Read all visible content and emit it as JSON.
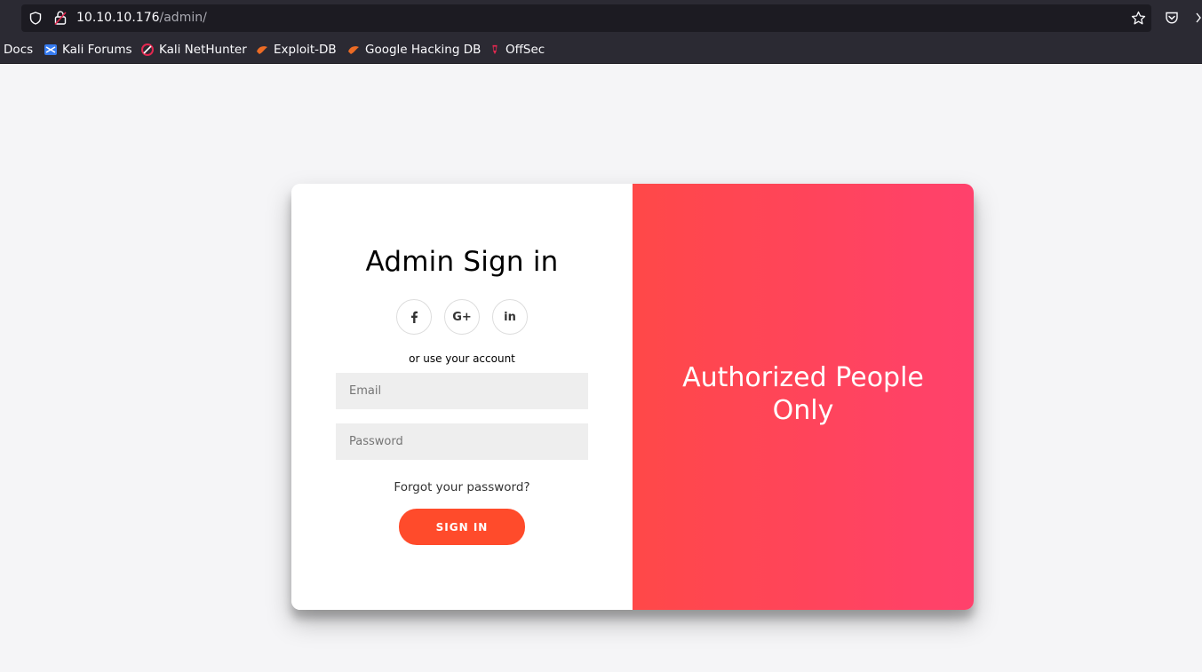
{
  "browser": {
    "url_host": "10.10.10.176",
    "url_path": "/admin/",
    "bookmarks": [
      {
        "label": "i Docs",
        "icon": "kali-docs-icon"
      },
      {
        "label": "Kali Forums",
        "icon": "kali-forums-icon"
      },
      {
        "label": "Kali NetHunter",
        "icon": "kali-nethunter-icon"
      },
      {
        "label": "Exploit-DB",
        "icon": "exploit-db-icon"
      },
      {
        "label": "Google Hacking DB",
        "icon": "google-hacking-db-icon"
      },
      {
        "label": "OffSec",
        "icon": "offsec-icon"
      }
    ]
  },
  "login": {
    "title": "Admin Sign in",
    "social": [
      {
        "label": "f",
        "icon": "facebook-icon"
      },
      {
        "label": "G+",
        "icon": "google-plus-icon"
      },
      {
        "label": "in",
        "icon": "linkedin-icon"
      }
    ],
    "alt_text": "or use your account",
    "email_placeholder": "Email",
    "password_placeholder": "Password",
    "forgot_link": "Forgot your password?",
    "submit_label": "SIGN IN"
  },
  "overlay": {
    "line1": "Authorized People",
    "line2": "Only"
  },
  "colors": {
    "accent": "#ff4b2b",
    "gradient_start": "#ff4848",
    "gradient_end": "#ff416c",
    "chrome_bg": "#2b2a33"
  }
}
